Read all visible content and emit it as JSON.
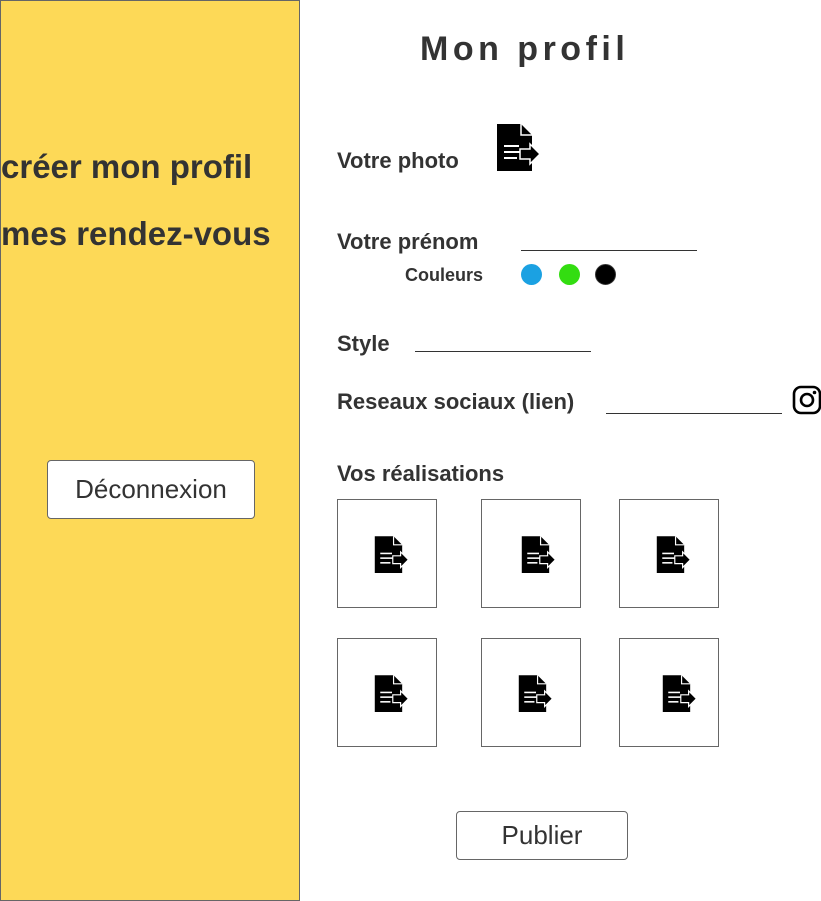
{
  "sidebar": {
    "items": [
      {
        "label": "créer mon profil"
      },
      {
        "label": "mes rendez-vous"
      }
    ],
    "logout_label": "Déconnexion",
    "background": "#FDD957"
  },
  "main": {
    "title": "Mon profil",
    "photo_label": "Votre photo",
    "photo_icon": "document-upload-icon",
    "firstname_label": "Votre prénom",
    "firstname_value": "",
    "colors_label": "Couleurs",
    "colors": [
      "#1BA1E2",
      "#33DD11",
      "#000000"
    ],
    "style_label": "Style",
    "style_value": "",
    "social_label": "Reseaux sociaux (lien)",
    "social_value": "",
    "social_icon": "instagram-icon",
    "works_label": "Vos réalisations",
    "works_icon": "document-upload-icon",
    "publish_label": "Publier"
  }
}
